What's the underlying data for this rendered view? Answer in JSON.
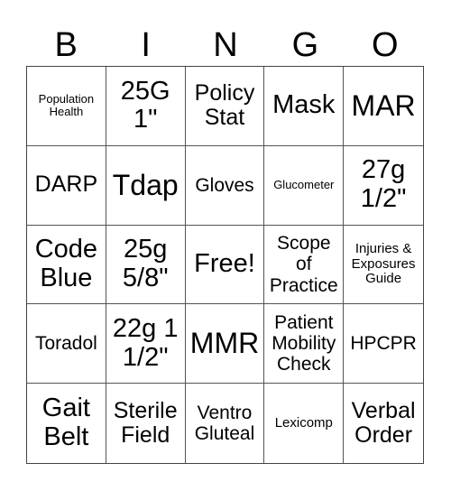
{
  "header": [
    "B",
    "I",
    "N",
    "G",
    "O"
  ],
  "cells": [
    {
      "text": "Population\nHealth",
      "size": "s-xs"
    },
    {
      "text": "25G\n1\"",
      "size": "s-xl"
    },
    {
      "text": "Policy\nStat",
      "size": "s-lg"
    },
    {
      "text": "Mask",
      "size": "s-xl"
    },
    {
      "text": "MAR",
      "size": "s-xxl"
    },
    {
      "text": "DARP",
      "size": "s-lg"
    },
    {
      "text": "Tdap",
      "size": "s-xxl"
    },
    {
      "text": "Gloves",
      "size": "s-md"
    },
    {
      "text": "Glucometer",
      "size": "s-xs"
    },
    {
      "text": "27g\n1/2\"",
      "size": "s-xl"
    },
    {
      "text": "Code\nBlue",
      "size": "s-xl"
    },
    {
      "text": "25g\n5/8\"",
      "size": "s-xl"
    },
    {
      "text": "Free!",
      "size": "s-xl"
    },
    {
      "text": "Scope\nof\nPractice",
      "size": "s-md"
    },
    {
      "text": "Injuries &\nExposures\nGuide",
      "size": "s-sm"
    },
    {
      "text": "Toradol",
      "size": "s-md"
    },
    {
      "text": "22g 1\n1/2\"",
      "size": "s-xl"
    },
    {
      "text": "MMR",
      "size": "s-xxl"
    },
    {
      "text": "Patient\nMobility\nCheck",
      "size": "s-md"
    },
    {
      "text": "HPCPR",
      "size": "s-md"
    },
    {
      "text": "Gait\nBelt",
      "size": "s-xl"
    },
    {
      "text": "Sterile\nField",
      "size": "s-lg"
    },
    {
      "text": "Ventro\nGluteal",
      "size": "s-md"
    },
    {
      "text": "Lexicomp",
      "size": "s-sm"
    },
    {
      "text": "Verbal\nOrder",
      "size": "s-lg"
    }
  ]
}
